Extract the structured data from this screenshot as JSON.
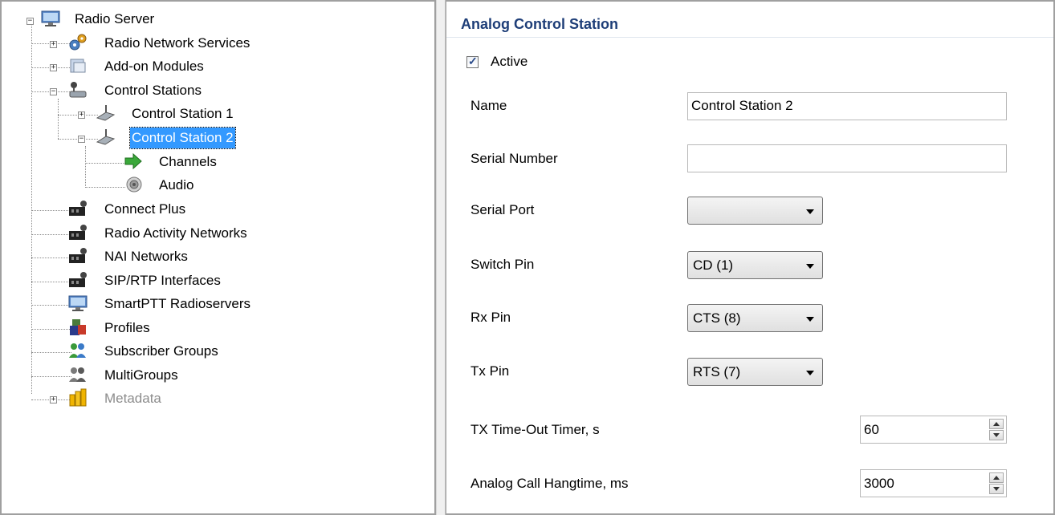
{
  "tree": {
    "root": {
      "label": "Radio Server",
      "icon": "monitor-server-icon",
      "expanded": true
    },
    "items": [
      {
        "label": "Radio Network Services",
        "icon": "gear-network-icon",
        "expander": "+"
      },
      {
        "label": "Add-on Modules",
        "icon": "modules-icon",
        "expander": "+"
      },
      {
        "label": "Control Stations",
        "icon": "radio-station-icon",
        "expander": "-"
      },
      {
        "label": "Control Station 1",
        "icon": "radio-icon",
        "expander": "+"
      },
      {
        "label": "Control Station 2",
        "icon": "radio-icon",
        "expander": "-",
        "selected": true
      },
      {
        "label": "Channels",
        "icon": "arrow-channels-icon"
      },
      {
        "label": "Audio",
        "icon": "speaker-icon"
      },
      {
        "label": "Connect Plus",
        "icon": "network-interface-icon"
      },
      {
        "label": "Radio Activity Networks",
        "icon": "network-interface-icon"
      },
      {
        "label": "NAI Networks",
        "icon": "network-interface-icon"
      },
      {
        "label": "SIP/RTP Interfaces",
        "icon": "network-interface-icon"
      },
      {
        "label": "SmartPTT Radioservers",
        "icon": "monitor-server-icon"
      },
      {
        "label": "Profiles",
        "icon": "profiles-icon"
      },
      {
        "label": "Subscriber Groups",
        "icon": "subscriber-groups-icon"
      },
      {
        "label": "MultiGroups",
        "icon": "multigroups-icon"
      },
      {
        "label": "Metadata",
        "icon": "metadata-icon",
        "expander": "+",
        "disabled": true
      }
    ]
  },
  "panel": {
    "title": "Analog Control Station",
    "active": {
      "label": "Active",
      "checked": true
    },
    "name": {
      "label": "Name",
      "value": "Control Station 2"
    },
    "serial_number": {
      "label": "Serial Number",
      "value": ""
    },
    "serial_port": {
      "label": "Serial Port",
      "value": ""
    },
    "switch_pin": {
      "label": "Switch Pin",
      "value": "CD (1)"
    },
    "rx_pin": {
      "label": "Rx Pin",
      "value": "CTS (8)"
    },
    "tx_pin": {
      "label": "Tx Pin",
      "value": "RTS (7)"
    },
    "tx_timeout": {
      "label": "TX Time-Out Timer, s",
      "value": "60"
    },
    "analog_hangtime": {
      "label": "Analog Call Hangtime, ms",
      "value": "3000"
    }
  },
  "colors": {
    "selection": "#3399ff",
    "header_text": "#1e3e78",
    "disabled_text": "#8c8c8c"
  }
}
